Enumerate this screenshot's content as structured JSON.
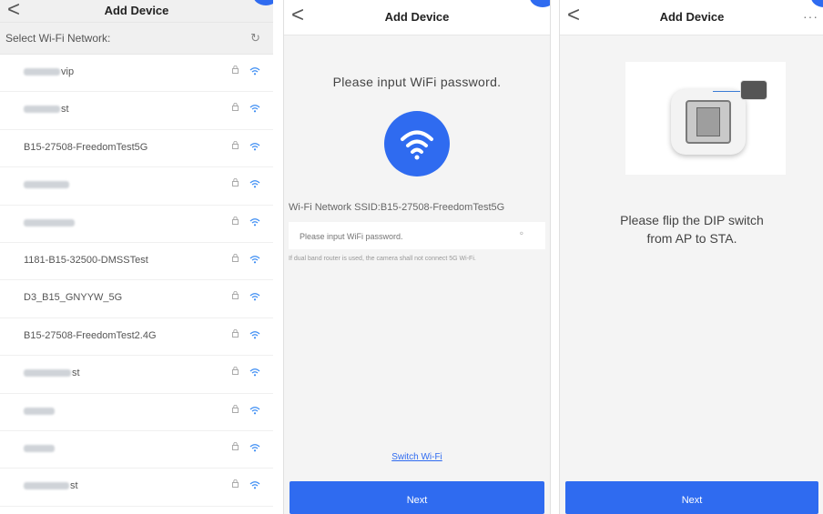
{
  "panel1": {
    "title": "Add Device",
    "back": "<",
    "select_label": "Select Wi-Fi Network:",
    "refresh": "↻",
    "networks": [
      {
        "prefix": "",
        "suffix": "vip",
        "blur": 40
      },
      {
        "prefix": "",
        "suffix": "st",
        "blur": 40
      },
      {
        "prefix": "B15-27508-FreedomTest5G",
        "suffix": "",
        "blur": 0
      },
      {
        "prefix": "",
        "suffix": "",
        "blur": 50
      },
      {
        "prefix": "",
        "suffix": "",
        "blur": 56
      },
      {
        "prefix": "1181-B15-32500-DMSSTest",
        "suffix": "",
        "blur": 0
      },
      {
        "prefix": "D3_B15_GNYYW_5G",
        "suffix": "",
        "blur": 0
      },
      {
        "prefix": "B15-27508-FreedomTest2.4G",
        "suffix": "",
        "blur": 0
      },
      {
        "prefix": "",
        "suffix": "st",
        "blur": 52
      },
      {
        "prefix": "",
        "suffix": "",
        "blur": 34
      },
      {
        "prefix": "",
        "suffix": "",
        "blur": 34
      },
      {
        "prefix": "",
        "suffix": "st",
        "blur": 50
      }
    ]
  },
  "panel2": {
    "title": "Add Device",
    "back": "<",
    "message": "Please input WiFi password.",
    "ssid_label": "Wi-Fi Network SSID:B15-27508-FreedomTest5G",
    "password_placeholder": "Please input WiFi password.",
    "note": "If dual band router is used, the camera shall not connect 5G Wi-Fi.",
    "switch_wifi": "Switch Wi-Fi",
    "next": "Next"
  },
  "panel3": {
    "title": "Add Device",
    "back": "<",
    "more": "···",
    "instruction": "Please flip the DIP switch\nfrom AP to STA.",
    "next": "Next"
  },
  "colors": {
    "accent": "#2f6bf0",
    "wifi_icon": "#3b8cf3",
    "lock_icon": "#aaaaaa"
  },
  "icons": {
    "back": "chevron-left-icon",
    "refresh": "refresh-icon",
    "lock": "lock-icon",
    "wifi": "wifi-icon",
    "eye": "eye-icon",
    "more": "more-icon"
  }
}
